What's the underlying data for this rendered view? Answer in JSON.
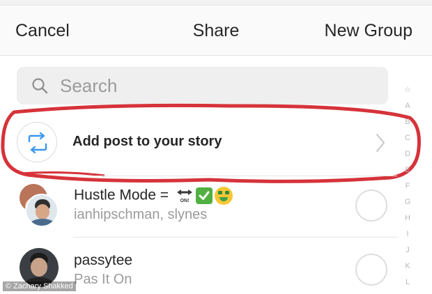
{
  "nav": {
    "cancel_label": "Cancel",
    "title": "Share",
    "new_group_label": "New Group"
  },
  "search": {
    "placeholder": "Search"
  },
  "story_row": {
    "label": "Add post to your story"
  },
  "conversations": [
    {
      "title": "Hustle Mode =",
      "emoji_arrow_text": "ON!",
      "subtitle": "ianhipschman, slynes"
    },
    {
      "title": "passytee",
      "subtitle": "Pas It On"
    }
  ],
  "alphabet_index": [
    "☆",
    "A",
    "B",
    "C",
    "D",
    "E",
    "F",
    "G",
    "H",
    "I",
    "J",
    "K",
    "L"
  ],
  "watermark": "© Zachary Shakked",
  "colors": {
    "highlight_circle": "#d6333a",
    "story_icon": "#3a97f0",
    "check_emoji": "#52b043",
    "placeholder_text": "#9b9b9b"
  }
}
